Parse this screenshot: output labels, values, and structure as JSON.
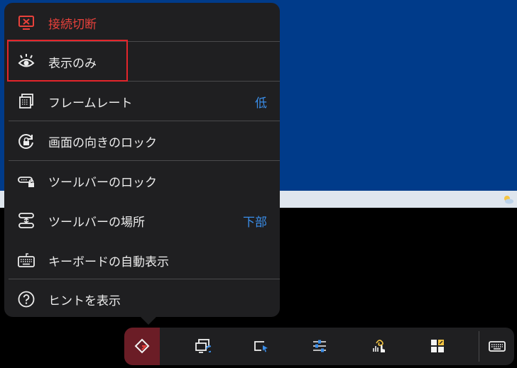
{
  "menu": {
    "items": [
      {
        "label": "接続切断",
        "icon": "disconnect-monitor-icon",
        "value": ""
      },
      {
        "label": "表示のみ",
        "icon": "eye-icon",
        "value": ""
      },
      {
        "label": "フレームレート",
        "icon": "frame-rate-icon",
        "value": "低"
      },
      {
        "label": "画面の向きのロック",
        "icon": "rotation-lock-icon",
        "value": ""
      },
      {
        "label": "ツールバーのロック",
        "icon": "toolbar-lock-icon",
        "value": ""
      },
      {
        "label": "ツールバーの場所",
        "icon": "toolbar-position-icon",
        "value": "下部"
      },
      {
        "label": "キーボードの自動表示",
        "icon": "keyboard-icon",
        "value": ""
      },
      {
        "label": "ヒントを表示",
        "icon": "help-icon",
        "value": ""
      }
    ]
  },
  "toolbar": {
    "buttons": [
      {
        "icon": "tool-diamond-icon",
        "active": true
      },
      {
        "icon": "switch-monitor-icon"
      },
      {
        "icon": "pointer-window-icon"
      },
      {
        "icon": "sliders-icon"
      },
      {
        "icon": "touch-gesture-icon"
      },
      {
        "icon": "apps-grid-icon"
      },
      {
        "icon": "keyboard-icon"
      }
    ]
  },
  "colors": {
    "accent_red": "#e8413b",
    "accent_blue": "#3a8eea",
    "menu_bg": "#1f1f21",
    "desktop_blue": "#003b8a"
  }
}
